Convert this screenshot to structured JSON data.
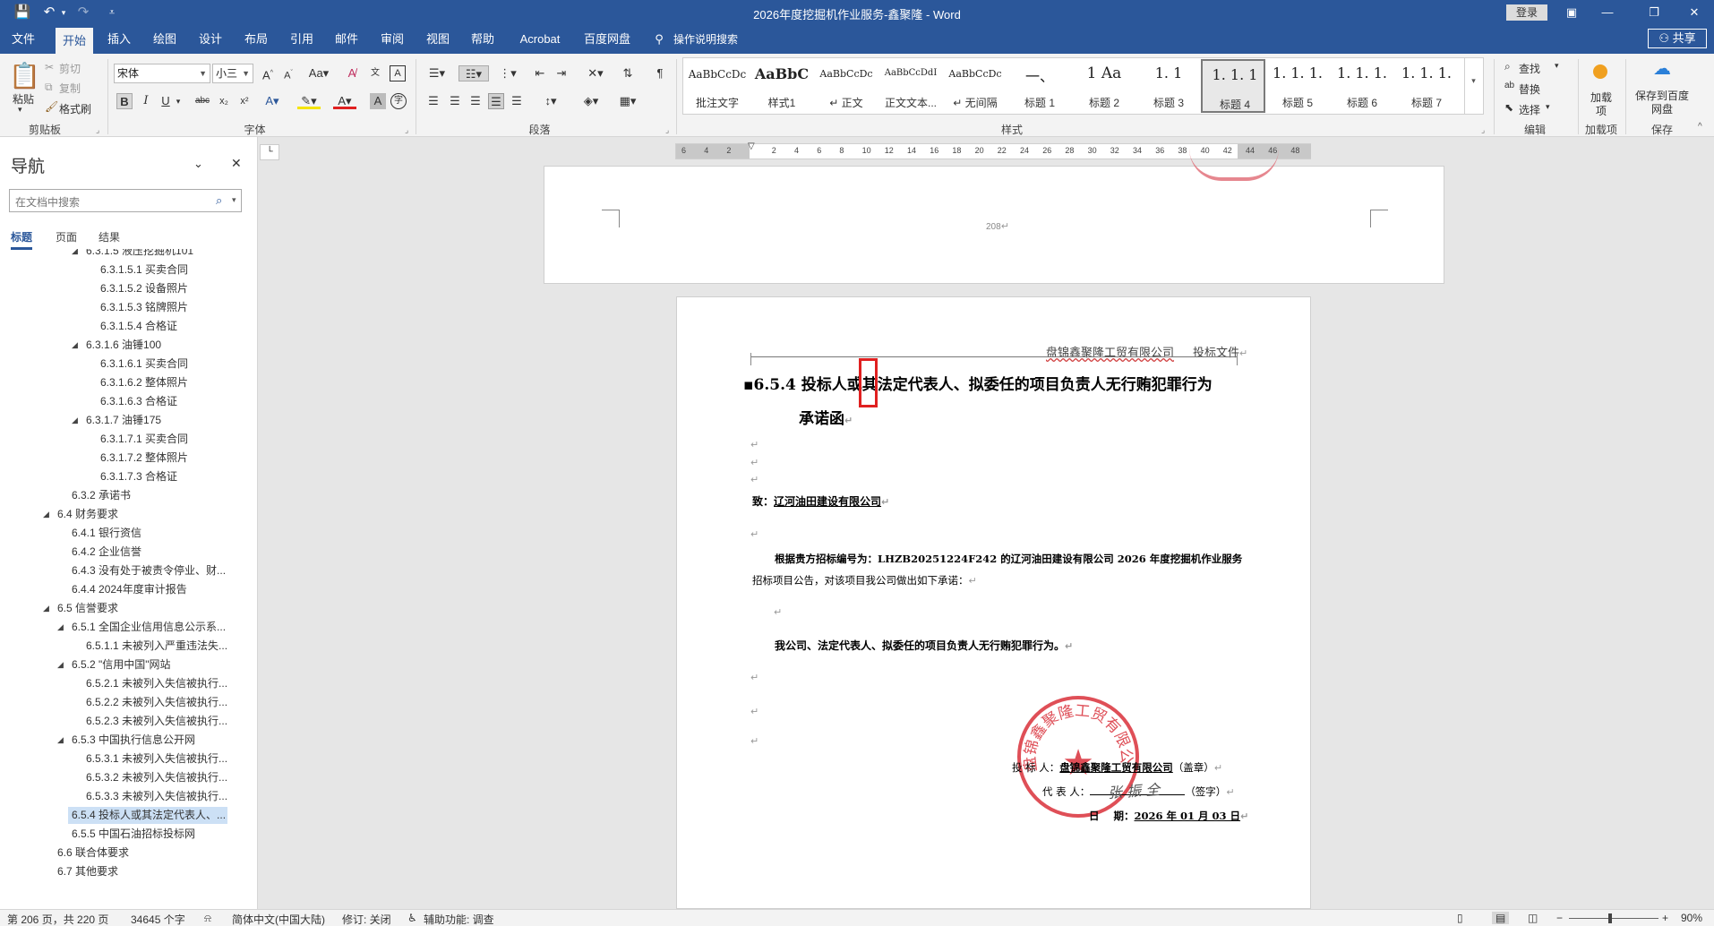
{
  "window": {
    "title": "2026年度挖掘机作业服务-鑫聚隆 - Word",
    "login": "登录",
    "share": "共享"
  },
  "tabs": [
    "文件",
    "开始",
    "插入",
    "绘图",
    "设计",
    "布局",
    "引用",
    "邮件",
    "审阅",
    "视图",
    "帮助",
    "Acrobat",
    "百度网盘",
    "操作说明搜索"
  ],
  "ribbon": {
    "clipboard": {
      "paste": "粘贴",
      "cut": "剪切",
      "copy": "复制",
      "format_painter": "格式刷",
      "label": "剪贴板"
    },
    "font": {
      "name": "宋体",
      "size": "小三",
      "label": "字体"
    },
    "paragraph": {
      "label": "段落"
    },
    "styles": {
      "label": "样式",
      "items": [
        {
          "preview": "AaBbCcDc",
          "name": "批注文字"
        },
        {
          "preview": "AaBbC",
          "name": "样式1"
        },
        {
          "preview": "AaBbCcDc",
          "name": "↵ 正文"
        },
        {
          "preview": "AaBbCcDdI",
          "name": "正文文本..."
        },
        {
          "preview": "AaBbCcDc",
          "name": "↵ 无间隔"
        },
        {
          "preview": "一、",
          "name": "标题 1"
        },
        {
          "preview": "1 Aa",
          "name": "标题 2"
        },
        {
          "preview": "1. 1",
          "name": "标题 3"
        },
        {
          "preview": "1. 1. 1",
          "name": "标题 4"
        },
        {
          "preview": "1. 1. 1.",
          "name": "标题 5"
        },
        {
          "preview": "1. 1. 1.",
          "name": "标题 6"
        },
        {
          "preview": "1. 1. 1.",
          "name": "标题 7"
        }
      ]
    },
    "editing": {
      "find": "查找",
      "replace": "替换",
      "select": "选择",
      "label": "编辑"
    },
    "addins": {
      "load": "加载项",
      "label": "加载项"
    },
    "save": {
      "baidu": "保存到百度网盘",
      "label": "保存"
    }
  },
  "nav": {
    "title": "导航",
    "search_placeholder": "在文档中搜索",
    "tabs": [
      "标题",
      "页面",
      "结果"
    ],
    "items": [
      {
        "text": "6.3.1.5 液压挖掘机101",
        "indent": 3,
        "tri": true
      },
      {
        "text": "6.3.1.5.1 买卖合同",
        "indent": 4
      },
      {
        "text": "6.3.1.5.2 设备照片",
        "indent": 4
      },
      {
        "text": "6.3.1.5.3 铭牌照片",
        "indent": 4
      },
      {
        "text": "6.3.1.5.4 合格证",
        "indent": 4
      },
      {
        "text": "6.3.1.6 油锤100",
        "indent": 3,
        "tri": true
      },
      {
        "text": "6.3.1.6.1 买卖合同",
        "indent": 4
      },
      {
        "text": "6.3.1.6.2 整体照片",
        "indent": 4
      },
      {
        "text": "6.3.1.6.3 合格证",
        "indent": 4
      },
      {
        "text": "6.3.1.7 油锤175",
        "indent": 3,
        "tri": true
      },
      {
        "text": "6.3.1.7.1 买卖合同",
        "indent": 4
      },
      {
        "text": "6.3.1.7.2 整体照片",
        "indent": 4
      },
      {
        "text": "6.3.1.7.3 合格证",
        "indent": 4
      },
      {
        "text": "6.3.2 承诺书",
        "indent": 2
      },
      {
        "text": "6.4 财务要求",
        "indent": 1,
        "tri": true
      },
      {
        "text": "6.4.1 银行资信",
        "indent": 2
      },
      {
        "text": "6.4.2 企业信誉",
        "indent": 2
      },
      {
        "text": "6.4.3 没有处于被责令停业、财...",
        "indent": 2
      },
      {
        "text": "6.4.4 2024年度审计报告",
        "indent": 2
      },
      {
        "text": "6.5 信誉要求",
        "indent": 1,
        "tri": true
      },
      {
        "text": "6.5.1 全国企业信用信息公示系...",
        "indent": 2,
        "tri": true
      },
      {
        "text": "6.5.1.1 未被列入严重违法失...",
        "indent": 3
      },
      {
        "text": "6.5.2 \"信用中国\"网站",
        "indent": 2,
        "tri": true
      },
      {
        "text": "6.5.2.1 未被列入失信被执行...",
        "indent": 3
      },
      {
        "text": "6.5.2.2 未被列入失信被执行...",
        "indent": 3
      },
      {
        "text": "6.5.2.3 未被列入失信被执行...",
        "indent": 3
      },
      {
        "text": "6.5.3 中国执行信息公开网",
        "indent": 2,
        "tri": true
      },
      {
        "text": "6.5.3.1 未被列入失信被执行...",
        "indent": 3
      },
      {
        "text": "6.5.3.2 未被列入失信被执行...",
        "indent": 3
      },
      {
        "text": "6.5.3.3 未被列入失信被执行...",
        "indent": 3
      },
      {
        "text": "6.5.4 投标人或其法定代表人、...",
        "indent": 2,
        "selected": true
      },
      {
        "text": "6.5.5 中国石油招标投标网",
        "indent": 2
      },
      {
        "text": "6.6 联合体要求",
        "indent": 1
      },
      {
        "text": "6.7 其他要求",
        "indent": 1
      }
    ]
  },
  "ruler": {
    "numbers": [
      "6",
      "4",
      "2",
      "",
      "2",
      "4",
      "6",
      "8",
      "10",
      "12",
      "14",
      "16",
      "18",
      "20",
      "22",
      "24",
      "26",
      "28",
      "30",
      "32",
      "34",
      "36",
      "38",
      "40",
      "42",
      "44",
      "46",
      "48"
    ]
  },
  "doc": {
    "prev_page_number": "208",
    "header_company": "盘锦鑫聚隆工贸有限公司",
    "header_doc": "投标文件",
    "heading_line1": "6.5.4 投标人或其法定代表人、拟委任的项目负责人无行贿犯罪行为",
    "heading_line2": "承诺函",
    "to_label": "致：",
    "to_value": "辽河油田建设有限公司",
    "body_line1": "根据贵方招标编号为：LHZB20251224F242 的辽河油田建设有限公司 2026 年度挖掘机作业服务",
    "body_line2": "招标项目公告，对该项目我公司做出如下承诺：",
    "commitment": "我公司、法定代表人、拟委任的项目负责人无行贿犯罪行为。",
    "bidder_label": "投 标 人：",
    "bidder_value": "盘锦鑫聚隆工贸有限公司",
    "bidder_note": "（盖章）",
    "rep_label": "代 表 人：",
    "rep_note": "（签字）",
    "date_label": "日    期：",
    "date_value": "2026 年 01 月 03 日",
    "seal_text": "盘锦鑫聚隆工贸有限公司",
    "signature": "张 振 全"
  },
  "status": {
    "page": "第 206 页，共 220 页",
    "words": "34645 个字",
    "lang": "简体中文(中国大陆)",
    "track": "修订: 关闭",
    "access": "辅助功能: 调查",
    "zoom": "90%"
  },
  "colors": {
    "brand": "#2b579a",
    "seal": "#d9303a",
    "highlight_box": "#e02020"
  }
}
